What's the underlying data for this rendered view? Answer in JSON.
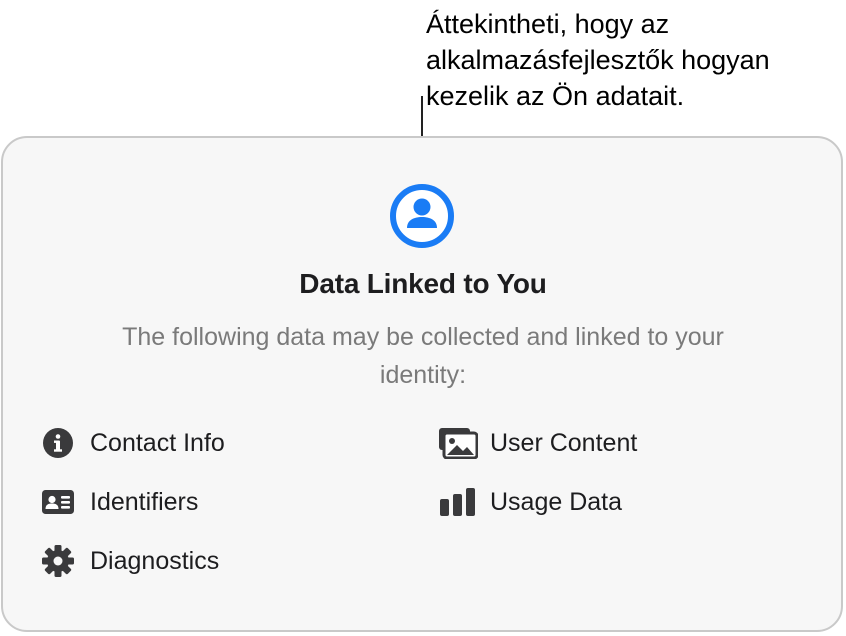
{
  "callout": {
    "lines": [
      "Áttekintheti, hogy az",
      "alkalmazásfejlesztők hogyan",
      "kezelik az Ön adatait."
    ]
  },
  "card": {
    "icon": "person-circle-icon",
    "accent_color": "#1a7cf5",
    "title": "Data Linked to You",
    "subtitle_lines": [
      "The following data may be collected and linked to your",
      "identity:"
    ],
    "items": [
      {
        "label": "Contact Info",
        "icon": "info-circle-icon"
      },
      {
        "label": "User Content",
        "icon": "photos-icon"
      },
      {
        "label": "Identifiers",
        "icon": "id-card-icon"
      },
      {
        "label": "Usage Data",
        "icon": "bar-chart-icon"
      },
      {
        "label": "Diagnostics",
        "icon": "gear-icon"
      }
    ]
  }
}
